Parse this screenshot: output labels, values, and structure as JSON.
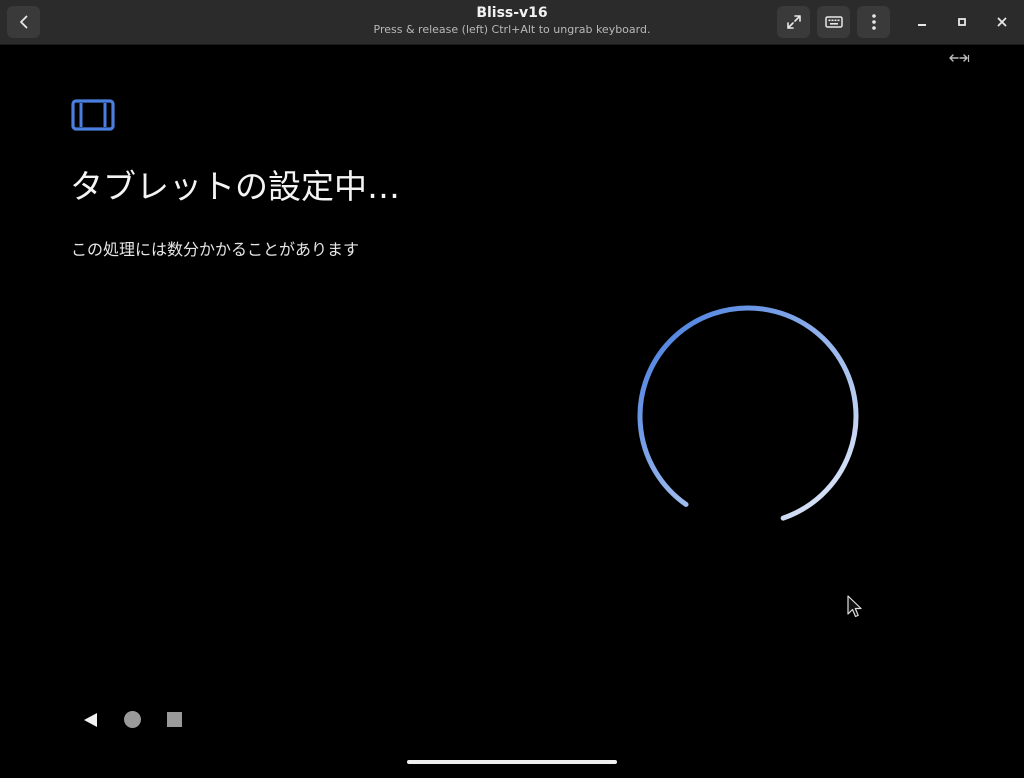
{
  "window": {
    "title": "Bliss-v16",
    "subtitle": "Press & release (left) Ctrl+Alt to ungrab keyboard."
  },
  "header_icons": {
    "back": "chevron-left-icon",
    "fullscreen": "expand-arrows-icon",
    "keyboard": "keyboard-icon",
    "menu": "kebab-menu-icon",
    "minimize": "minimize-icon",
    "maximize": "maximize-icon",
    "close": "close-icon"
  },
  "setup": {
    "heading": "タブレットの設定中…",
    "description": "この処理には数分かかることがあります",
    "icon": "tablet-icon",
    "spinner_progress": 0.85
  },
  "nav": {
    "back": "triangle-back-icon",
    "home": "circle-home-icon",
    "recents": "square-recents-icon"
  },
  "colors": {
    "accent": "#4a7fe0",
    "spinner_start": "#3f78de",
    "spinner_end": "#e9eef9",
    "headerbar": "#2b2b2b",
    "background": "#000000"
  }
}
